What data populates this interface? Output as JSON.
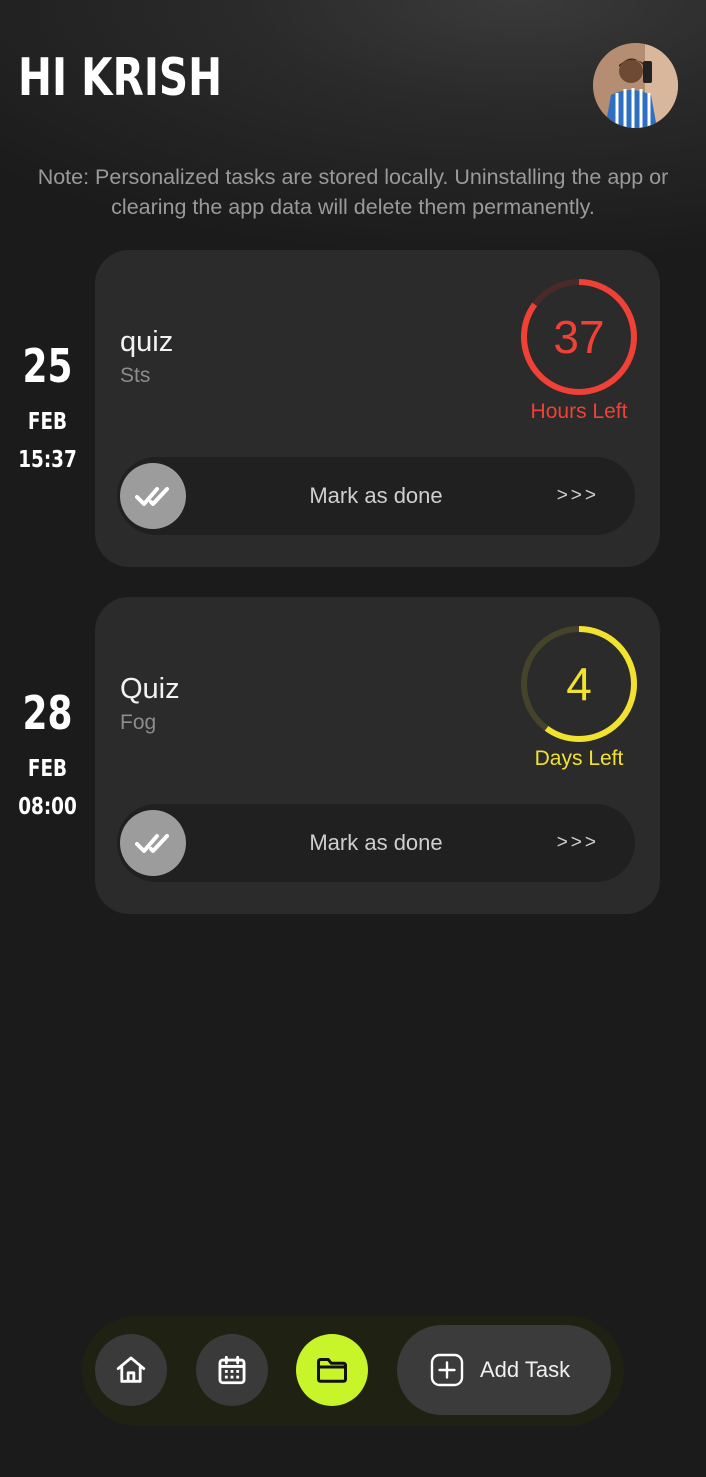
{
  "header": {
    "greeting": "HI KRISH"
  },
  "note": "Note: Personalized tasks are stored locally. Uninstalling the app or clearing the app data will delete them permanently.",
  "tasks": [
    {
      "day": "25",
      "month": "FEB",
      "time": "15:37",
      "title": "quiz",
      "subtitle": "Sts",
      "remaining_value": "37",
      "remaining_label": "Hours Left",
      "remaining_fraction": 0.85,
      "color": "#ef4136",
      "track_color": "#4a2a28",
      "done_label": "Mark as done",
      "arrows": ">>>"
    },
    {
      "day": "28",
      "month": "FEB",
      "time": "08:00",
      "title": "Quiz",
      "subtitle": "Fog",
      "remaining_value": "4",
      "remaining_label": "Days Left",
      "remaining_fraction": 0.6,
      "color": "#f2e230",
      "track_color": "#45432a",
      "done_label": "Mark as done",
      "arrows": ">>>"
    }
  ],
  "nav": {
    "items": [
      {
        "icon": "home-icon",
        "active": false
      },
      {
        "icon": "calendar-icon",
        "active": false
      },
      {
        "icon": "folder-icon",
        "active": true
      }
    ],
    "add_label": "Add Task",
    "active_color": "#c7f52a"
  }
}
